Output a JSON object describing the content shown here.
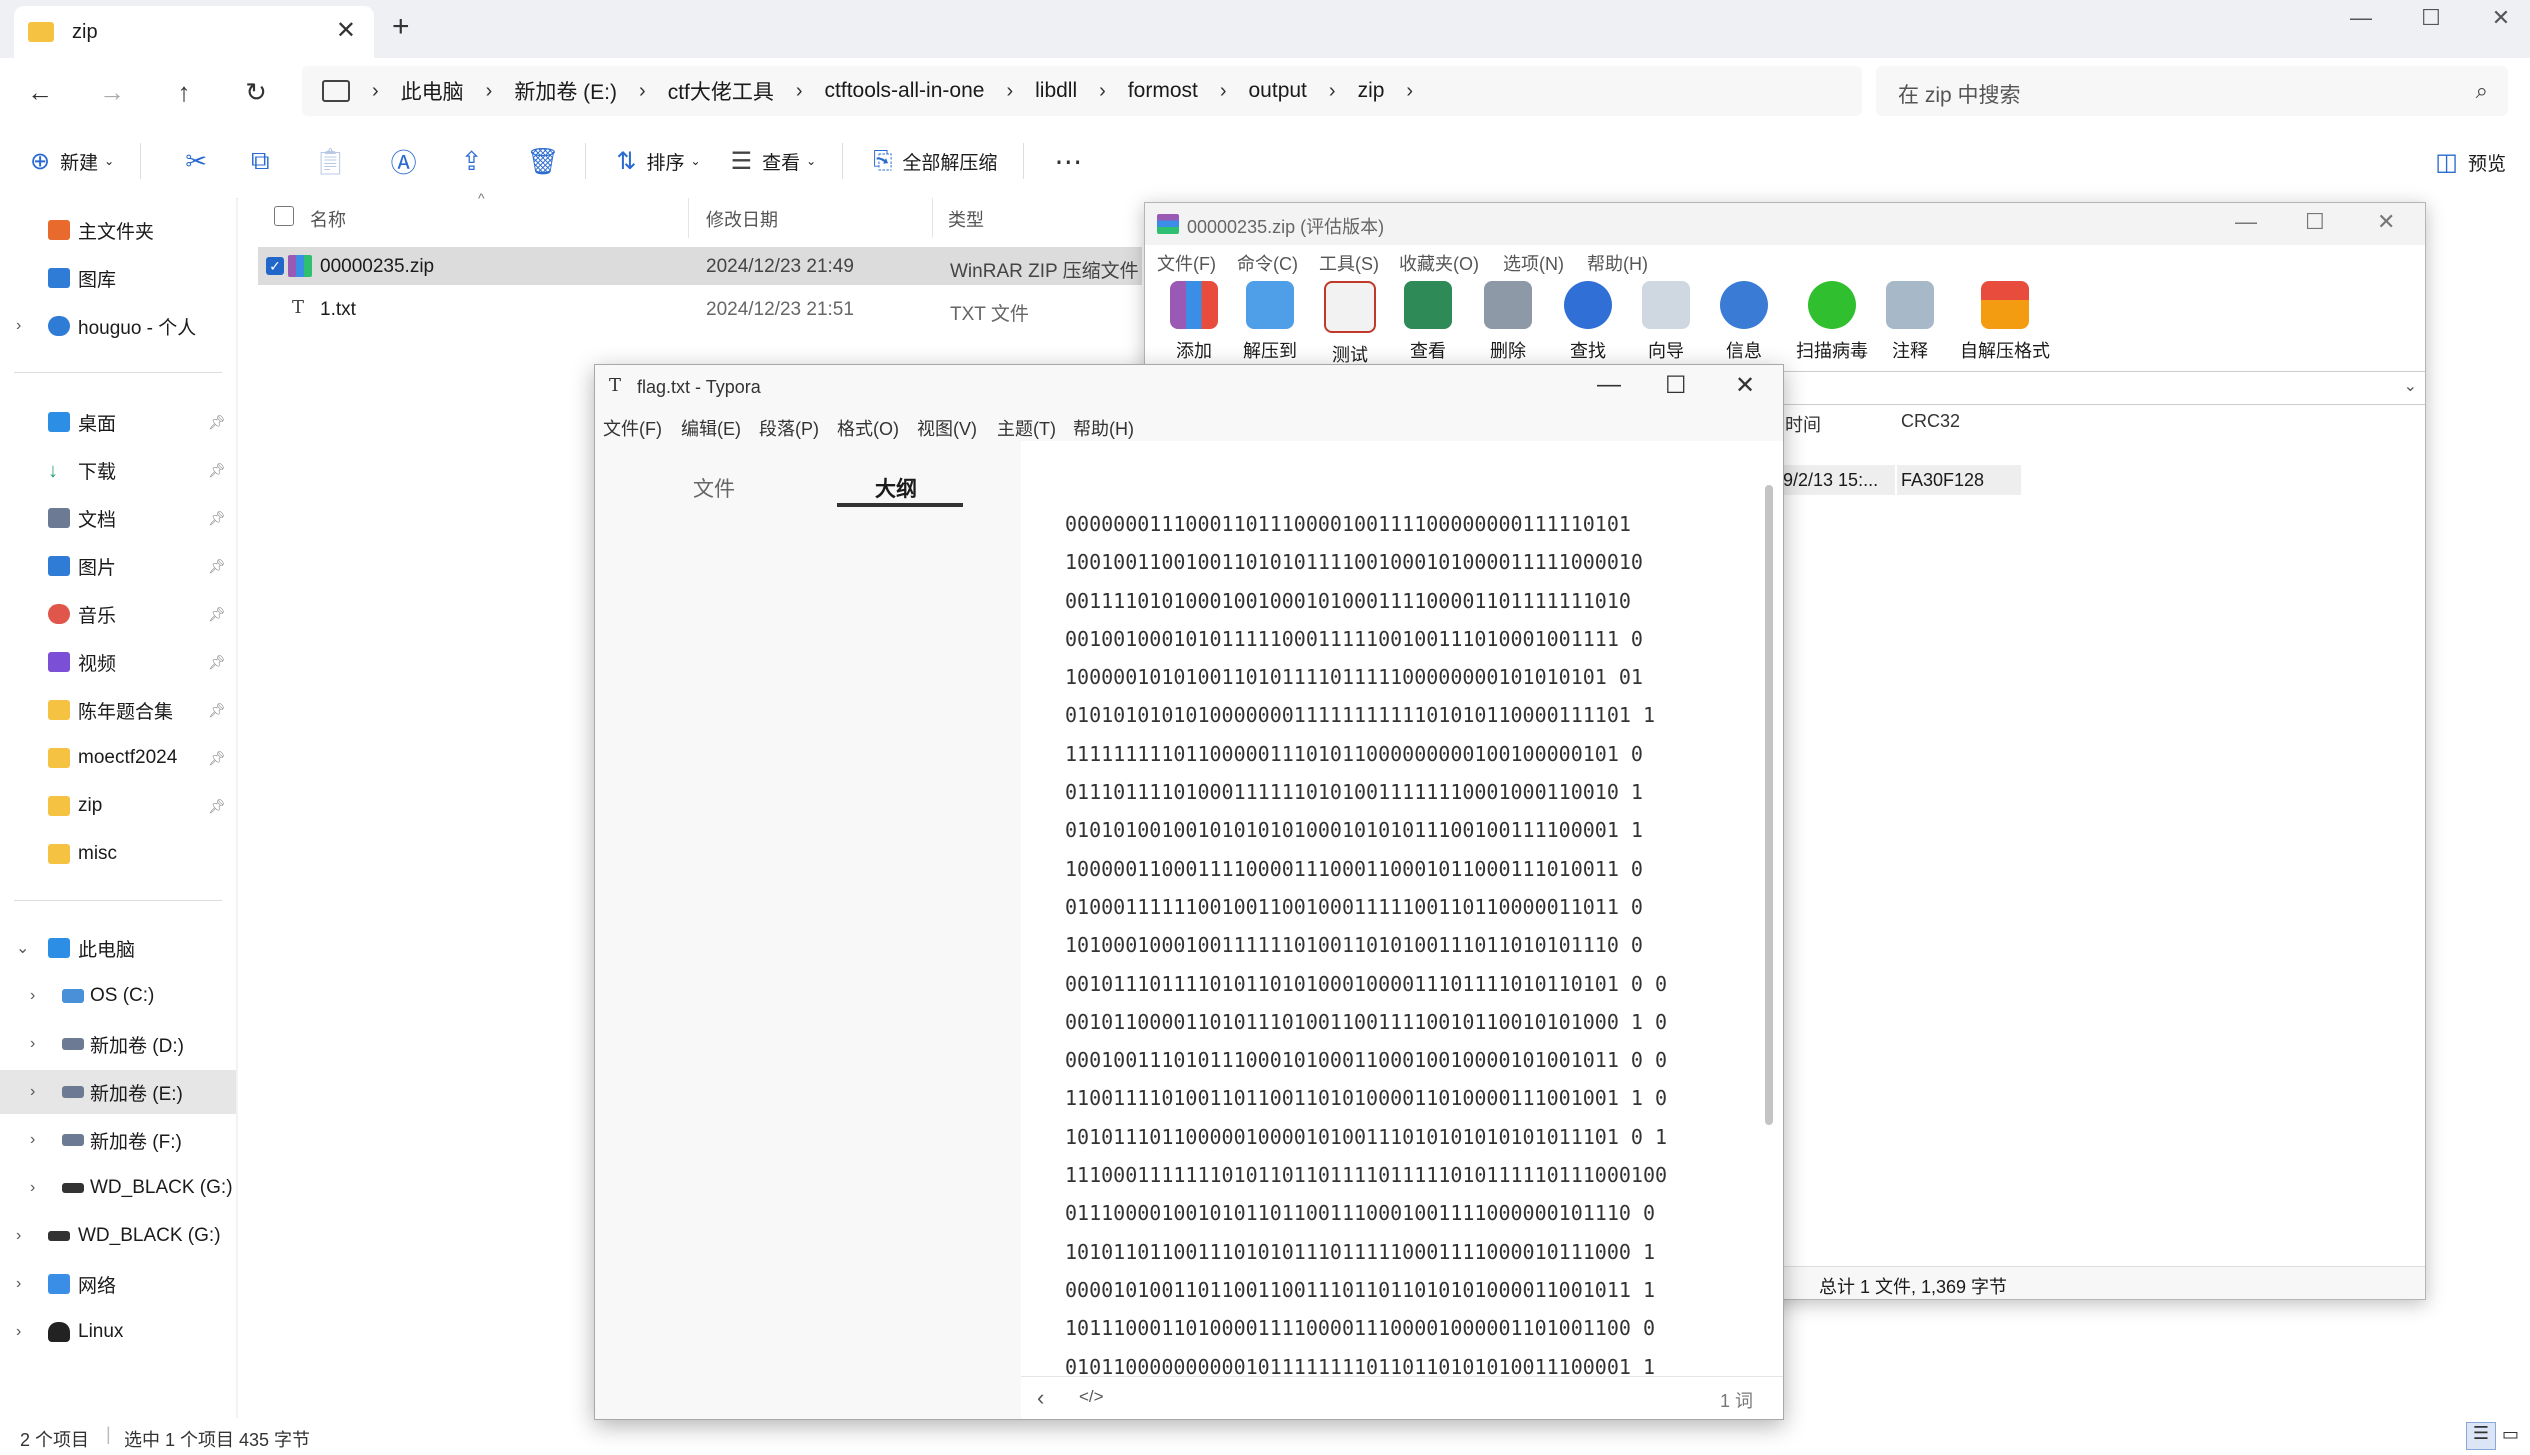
{
  "explorer": {
    "tab_title": "zip",
    "breadcrumbs": [
      "此电脑",
      "新加卷 (E:)",
      "ctf大佬工具",
      "ctftools-all-in-one",
      "libdll",
      "formost",
      "output",
      "zip"
    ],
    "search_placeholder": "在 zip 中搜索",
    "commands": {
      "new": "新建",
      "sort": "排序",
      "view": "查看",
      "extract_all": "全部解压缩",
      "preview": "预览"
    },
    "sidebar": {
      "home": "主文件夹",
      "gallery": "图库",
      "onedrive": "houguo - 个人",
      "quick": [
        "桌面",
        "下载",
        "文档",
        "图片",
        "音乐",
        "视频",
        "陈年题合集",
        "moectf2024",
        "zip",
        "misc"
      ],
      "pc": "此电脑",
      "drives": [
        "OS (C:)",
        "新加卷 (D:)",
        "新加卷 (E:)",
        "新加卷 (F:)",
        "WD_BLACK (G:)"
      ],
      "wd": "WD_BLACK (G:)",
      "network": "网络",
      "linux": "Linux"
    },
    "columns": {
      "name": "名称",
      "date": "修改日期",
      "type": "类型"
    },
    "files": [
      {
        "name": "00000235.zip",
        "date": "2024/12/23 21:49",
        "type": "WinRAR ZIP 压缩文件"
      },
      {
        "name": "1.txt",
        "date": "2024/12/23 21:51",
        "type": "TXT 文件"
      }
    ],
    "status": {
      "count": "2 个项目",
      "selected": "选中 1 个项目  435 字节"
    }
  },
  "winrar": {
    "title": "00000235.zip (评估版本)",
    "menu": [
      "文件(F)",
      "命令(C)",
      "工具(S)",
      "收藏夹(O)",
      "选项(N)",
      "帮助(H)"
    ],
    "tools": [
      "添加",
      "解压到",
      "测试",
      "查看",
      "删除",
      "查找",
      "向导",
      "信息",
      "扫描病毒",
      "注释",
      "自解压格式"
    ],
    "col_time": "时间",
    "col_crc": "CRC32",
    "row_time": "9/2/13 15:...",
    "row_crc": "FA30F128",
    "status": "总计 1 文件, 1,369 字节"
  },
  "typora": {
    "title": "flag.txt - Typora",
    "menu": [
      "文件(F)",
      "编辑(E)",
      "段落(P)",
      "格式(O)",
      "视图(V)",
      "主题(T)",
      "帮助(H)"
    ],
    "tab_files": "文件",
    "tab_outline": "大纲",
    "word_count": "1 词",
    "lines": [
      "00000001110001101110000100111100000000111110101",
      "100100110010011010101111001000101000011111000010",
      "00111101010001001000101000111100001101111111010",
      "0010010001010111110001111100100111010001001111 0",
      "100000101010011010111101111100000000101010101 01",
      "01010101010100000001111111111101010110000111101 1",
      "1111111110110000011101011000000000100100000101 0",
      "0111011110100011111101010011111110001000110010 1",
      "0101010010010101010100010101011100100111100001 1",
      "1000001100011110000111000110001011000111010011 0",
      "0100011111100100110010001111100110110000011011 0",
      "1010001000100111111010011010100111011010101110 0",
      "0010111011110101101010001000011101111010110101 0 0",
      "0010110000110101110100110011110010110010101000 1 0",
      "0001001110101110001010001100010010000101001011 0 0",
      "1100111101001101100110101000011010000111001001 1 0",
      "1010111011000001000010100111010101010101011101 0 1",
      "11100011111110101101101111011111010111110111000100",
      "01110000100101011011001110001001111000000101110 0",
      "10101101100111010101110111110001111000010111000 1",
      "00001010011011001100111011011010101000011001011 1",
      "10111000110100001111000011100001000001101001100 0",
      "01011000000000010111111110110110101010011100001 1"
    ]
  }
}
